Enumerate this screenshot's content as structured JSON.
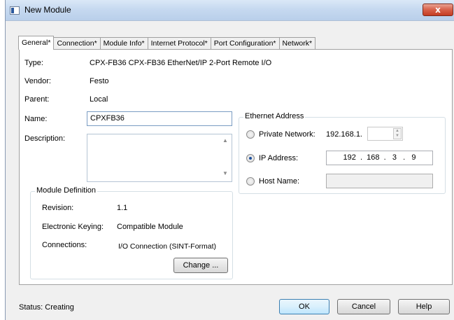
{
  "window": {
    "title": "New Module",
    "close_glyph": "x"
  },
  "tabs": [
    {
      "label": "General*"
    },
    {
      "label": "Connection*"
    },
    {
      "label": "Module Info*"
    },
    {
      "label": "Internet Protocol*"
    },
    {
      "label": "Port Configuration*"
    },
    {
      "label": "Network*"
    }
  ],
  "general": {
    "type_label": "Type:",
    "type_value": "CPX-FB36 CPX-FB36 EtherNet/IP 2-Port Remote I/O",
    "vendor_label": "Vendor:",
    "vendor_value": "Festo",
    "parent_label": "Parent:",
    "parent_value": "Local",
    "name_label": "Name:",
    "name_value": "CPXFB36",
    "description_label": "Description:",
    "description_value": ""
  },
  "module_definition": {
    "title": "Module Definition",
    "revision_label": "Revision:",
    "revision_value": "1.1",
    "keying_label": "Electronic Keying:",
    "keying_value": "Compatible Module",
    "connections_label": "Connections:",
    "connections_value": "I/O Connection (SINT-Format)",
    "change_button": "Change ..."
  },
  "ethernet": {
    "title": "Ethernet Address",
    "private_label": "Private Network:",
    "private_prefix": "192.168.1.",
    "private_value": "",
    "ip_label": "IP Address:",
    "ip_value": "192  .  168  .   3   .   9",
    "host_label": "Host Name:",
    "host_value": "",
    "selected": "IP Address"
  },
  "footer": {
    "status": "Status:  Creating",
    "ok": "OK",
    "cancel": "Cancel",
    "help": "Help"
  }
}
